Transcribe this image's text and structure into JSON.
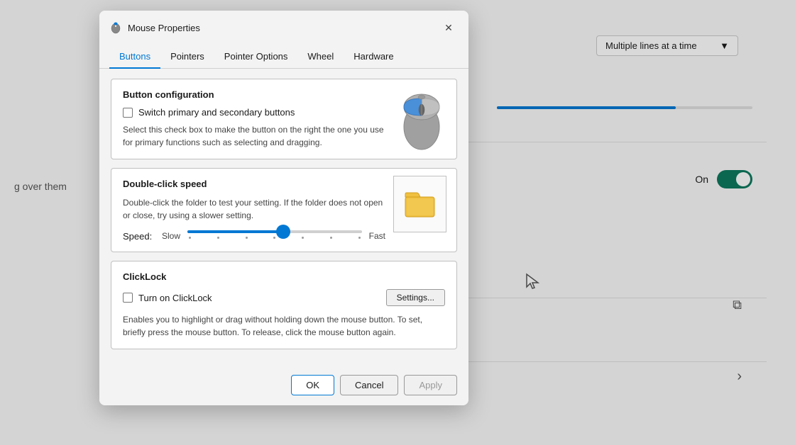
{
  "background": {
    "dropdown_label": "Multiple lines at a time",
    "dropdown_arrow": "▼",
    "toggle_label": "On",
    "left_text": "g over them",
    "external_link_icon": "⧉",
    "chevron_icon": "›"
  },
  "dialog": {
    "title": "Mouse Properties",
    "close_button": "✕",
    "tabs": [
      {
        "id": "buttons",
        "label": "Buttons",
        "active": true
      },
      {
        "id": "pointers",
        "label": "Pointers",
        "active": false
      },
      {
        "id": "pointer-options",
        "label": "Pointer Options",
        "active": false
      },
      {
        "id": "wheel",
        "label": "Wheel",
        "active": false
      },
      {
        "id": "hardware",
        "label": "Hardware",
        "active": false
      }
    ],
    "sections": {
      "button_config": {
        "title": "Button configuration",
        "checkbox_label": "Switch primary and secondary buttons",
        "description": "Select this check box to make the button on the right the one you use for primary functions such as selecting and dragging."
      },
      "double_click": {
        "title": "Double-click speed",
        "description": "Double-click the folder to test your setting. If the folder does not open or close, try using a slower setting.",
        "speed_label": "Speed:",
        "slow_label": "Slow",
        "fast_label": "Fast",
        "speed_percent": 55
      },
      "click_lock": {
        "title": "ClickLock",
        "checkbox_label": "Turn on ClickLock",
        "settings_button": "Settings...",
        "description": "Enables you to highlight or drag without holding down the mouse button. To set, briefly press the mouse button. To release, click the mouse button again."
      }
    },
    "buttons": {
      "ok": "OK",
      "cancel": "Cancel",
      "apply": "Apply"
    }
  }
}
